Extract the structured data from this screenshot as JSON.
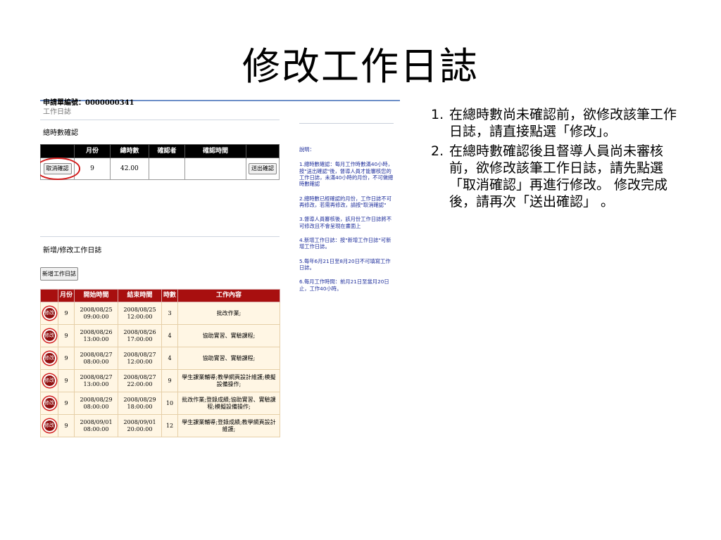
{
  "slide": {
    "title": "修改工作日誌",
    "bullets": [
      {
        "num": "1.",
        "text": "在總時數尚未確認前，欲修改該筆工作日誌，請直接點選「修改」。"
      },
      {
        "num": "2.",
        "text": "在總時數確認後且督導人員尚未審核前，欲修改該筆工作日誌，請先點選「取消確認」再進行修改。 修改完成後，請再次「送出確認」 。"
      }
    ]
  },
  "screenshot": {
    "application_number_label": "申請單編號：0000000341",
    "breadcrumb": "工作日誌",
    "hours_confirm": {
      "section_title": "總時數確認",
      "columns": [
        "",
        "月份",
        "總時數",
        "確認者",
        "確認時間",
        ""
      ],
      "row": {
        "cancel_button": "取消確認",
        "month": "9",
        "total_hours": "42.00",
        "confirmer": "",
        "confirm_time": "",
        "submit_button": "送出確認"
      }
    },
    "log_section_title": "新增/修改工作日誌",
    "add_button": "新增工作日誌",
    "log_table": {
      "columns": [
        "",
        "月份",
        "開始時間",
        "結束時間",
        "時數",
        "工作內容"
      ],
      "edit_label": "修改",
      "rows": [
        {
          "month": "9",
          "start_date": "2008/08/25",
          "start_time": "09:00:00",
          "end_date": "2008/08/25",
          "end_time": "12:00:00",
          "hours": "3",
          "content": "批改作業;"
        },
        {
          "month": "9",
          "start_date": "2008/08/26",
          "start_time": "13:00:00",
          "end_date": "2008/08/26",
          "end_time": "17:00:00",
          "hours": "4",
          "content": "協助實習、實驗課程;"
        },
        {
          "month": "9",
          "start_date": "2008/08/27",
          "start_time": "08:00:00",
          "end_date": "2008/08/27",
          "end_time": "12:00:00",
          "hours": "4",
          "content": "協助實習、實驗課程;"
        },
        {
          "month": "9",
          "start_date": "2008/08/27",
          "start_time": "13:00:00",
          "end_date": "2008/08/27",
          "end_time": "22:00:00",
          "hours": "9",
          "content": "學生課業輔導;教學網頁設計維護;模擬設備操作;"
        },
        {
          "month": "9",
          "start_date": "2008/08/29",
          "start_time": "08:00:00",
          "end_date": "2008/08/29",
          "end_time": "18:00:00",
          "hours": "10",
          "content": "批改作業;登錄成績;協助實習、實驗課程;模擬設備操作;"
        },
        {
          "month": "9",
          "start_date": "2008/09/01",
          "start_time": "08:00:00",
          "end_date": "2008/09/01",
          "end_time": "20:00:00",
          "hours": "12",
          "content": "學生課業輔導;登錄成績;教學網頁設計維護;"
        }
      ]
    },
    "notes": {
      "heading": "說明：",
      "items": [
        "1.總時數確認：每月工作時數滿40小時，按\"送出確認\"後，督導人員才能審核您的工作日誌，未滿40小時的月份，不可做總時數確認",
        "2.總時數已經確認的月份，工作日誌不可再修改，若需再修改，請按\"取消確認\"",
        "3.督導人員審核後，該月份工作日誌將不可修改且不會呈現在畫面上",
        "4.新增工作日誌：按\"新增工作日誌\"可新增工作日誌。",
        "5.每年6月21日至8月20日不可填寫工作日誌。",
        "6.每月工作時間：前月21日至當月20日止，工作40小時。"
      ]
    },
    "colors": {
      "accent_red": "#a80f0f",
      "highlight_circle": "#d21b1b",
      "notes_text": "#1f2f9c"
    }
  }
}
